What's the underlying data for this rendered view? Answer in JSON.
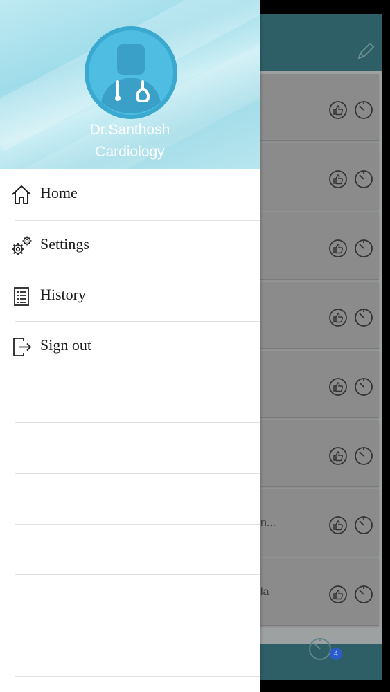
{
  "drawer": {
    "doctor_name": "Dr.Santhosh",
    "department": "Cardiology",
    "menu": [
      {
        "label": "Home",
        "icon": "home-icon"
      },
      {
        "label": "Settings",
        "icon": "gears-icon"
      },
      {
        "label": "History",
        "icon": "list-icon"
      },
      {
        "label": "Sign out",
        "icon": "sign-out-icon"
      }
    ]
  },
  "background": {
    "cards": [
      {
        "text": ""
      },
      {
        "text": ""
      },
      {
        "text": ""
      },
      {
        "text": ""
      },
      {
        "text": ""
      },
      {
        "text": ""
      },
      {
        "text": "n..."
      },
      {
        "text": "la"
      }
    ],
    "footer_badge": "4"
  },
  "colors": {
    "header_teal": "#2f5f66",
    "drawer_header_cyan": "#9fdcea",
    "avatar_circle": "#4fbde2",
    "badge_blue": "#2b5cc9"
  }
}
